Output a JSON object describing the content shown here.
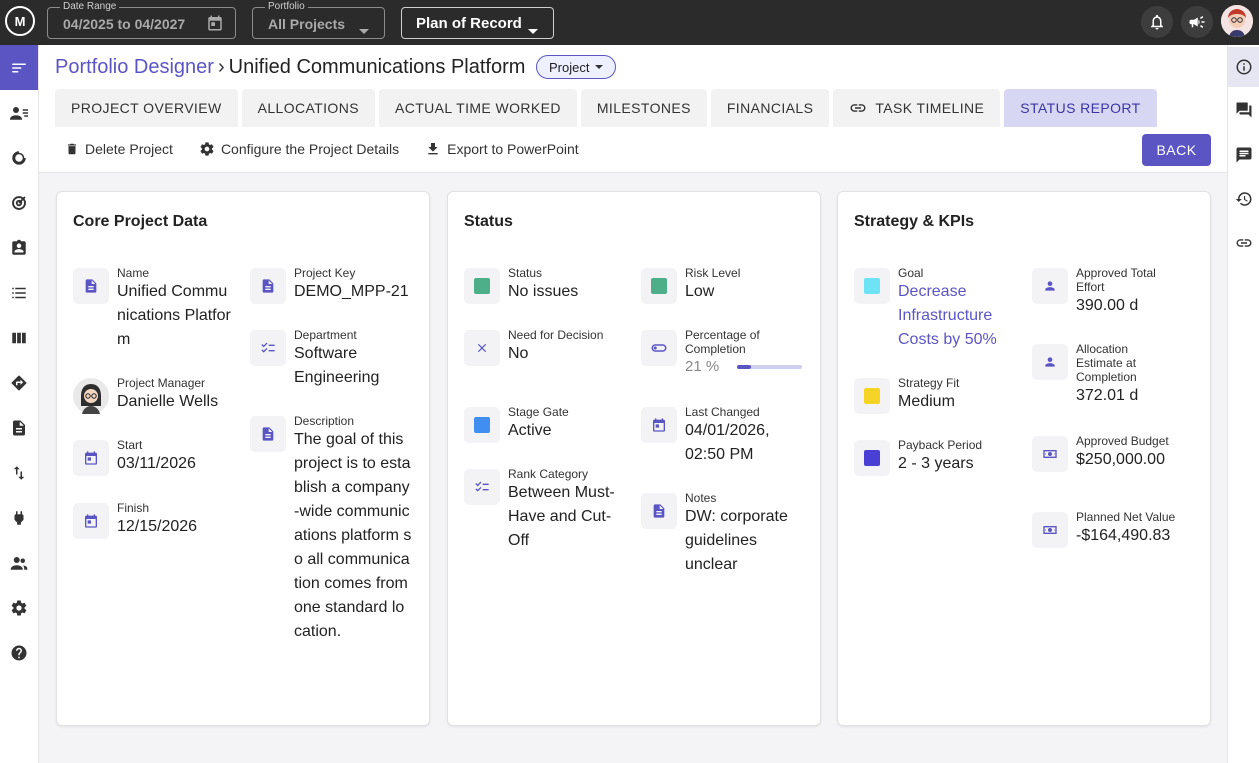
{
  "topbar": {
    "logo_text": "M",
    "date_range": {
      "label": "Date Range",
      "value": "04/2025 to 04/2027"
    },
    "portfolio": {
      "label": "Portfolio",
      "value": "All Projects"
    },
    "plan": {
      "value": "Plan of Record"
    }
  },
  "breadcrumb": {
    "parent": "Portfolio Designer",
    "current": "Unified Communications Platform",
    "type_chip": "Project"
  },
  "tabs": [
    {
      "label": "PROJECT OVERVIEW"
    },
    {
      "label": "ALLOCATIONS"
    },
    {
      "label": "ACTUAL TIME WORKED"
    },
    {
      "label": "MILESTONES"
    },
    {
      "label": "FINANCIALS"
    },
    {
      "label": "TASK TIMELINE",
      "icon": "link-icon"
    },
    {
      "label": "STATUS REPORT",
      "active": true
    }
  ],
  "toolbar": {
    "delete": "Delete Project",
    "configure": "Configure the Project Details",
    "export": "Export to PowerPoint",
    "back": "BACK"
  },
  "core": {
    "title": "Core Project Data",
    "name": {
      "label": "Name",
      "value": "Unified Communications Platform"
    },
    "manager": {
      "label": "Project Manager",
      "value": "Danielle Wells"
    },
    "start": {
      "label": "Start",
      "value": "03/11/2026"
    },
    "finish": {
      "label": "Finish",
      "value": "12/15/2026"
    },
    "key": {
      "label": "Project Key",
      "value": "DEMO_MPP-21"
    },
    "department": {
      "label": "Department",
      "value": "Software Engineering"
    },
    "description": {
      "label": "Description",
      "value": "The goal of this project is to establish a company-wide communications platform so all communication comes from one standard location."
    }
  },
  "status": {
    "title": "Status",
    "status": {
      "label": "Status",
      "value": "No issues",
      "color": "#4caf89"
    },
    "need": {
      "label": "Need for Decision",
      "value": "No"
    },
    "gate": {
      "label": "Stage Gate",
      "value": "Active",
      "color": "#3f8ef0"
    },
    "rank": {
      "label": "Rank Category",
      "value": "Between Must-Have and Cut-Off"
    },
    "risk": {
      "label": "Risk Level",
      "value": "Low",
      "color": "#4caf89"
    },
    "completion": {
      "label": "Percentage of Completion",
      "value": "21 %",
      "fraction": 0.21
    },
    "changed": {
      "label": "Last Changed",
      "value": "04/01/2026, 02:50 PM"
    },
    "notes": {
      "label": "Notes",
      "value": "DW: corporate guidelines unclear"
    }
  },
  "strategy": {
    "title": "Strategy & KPIs",
    "goal": {
      "label": "Goal",
      "value": "Decrease Infrastructure Costs by 50%",
      "color": "#6ee3f5"
    },
    "fit": {
      "label": "Strategy Fit",
      "value": "Medium",
      "color": "#f5d327"
    },
    "payback": {
      "label": "Payback Period",
      "value": "2 - 3 years",
      "color": "#4a3fd4"
    },
    "effort": {
      "label": "Approved Total Effort",
      "value": "390.00 d"
    },
    "allocation": {
      "label": "Allocation Estimate at Completion",
      "value": "372.01 d"
    },
    "budget": {
      "label": "Approved Budget",
      "value": "$250,000.00"
    },
    "npv": {
      "label": "Planned Net Value",
      "value": "-$164,490.83"
    }
  }
}
